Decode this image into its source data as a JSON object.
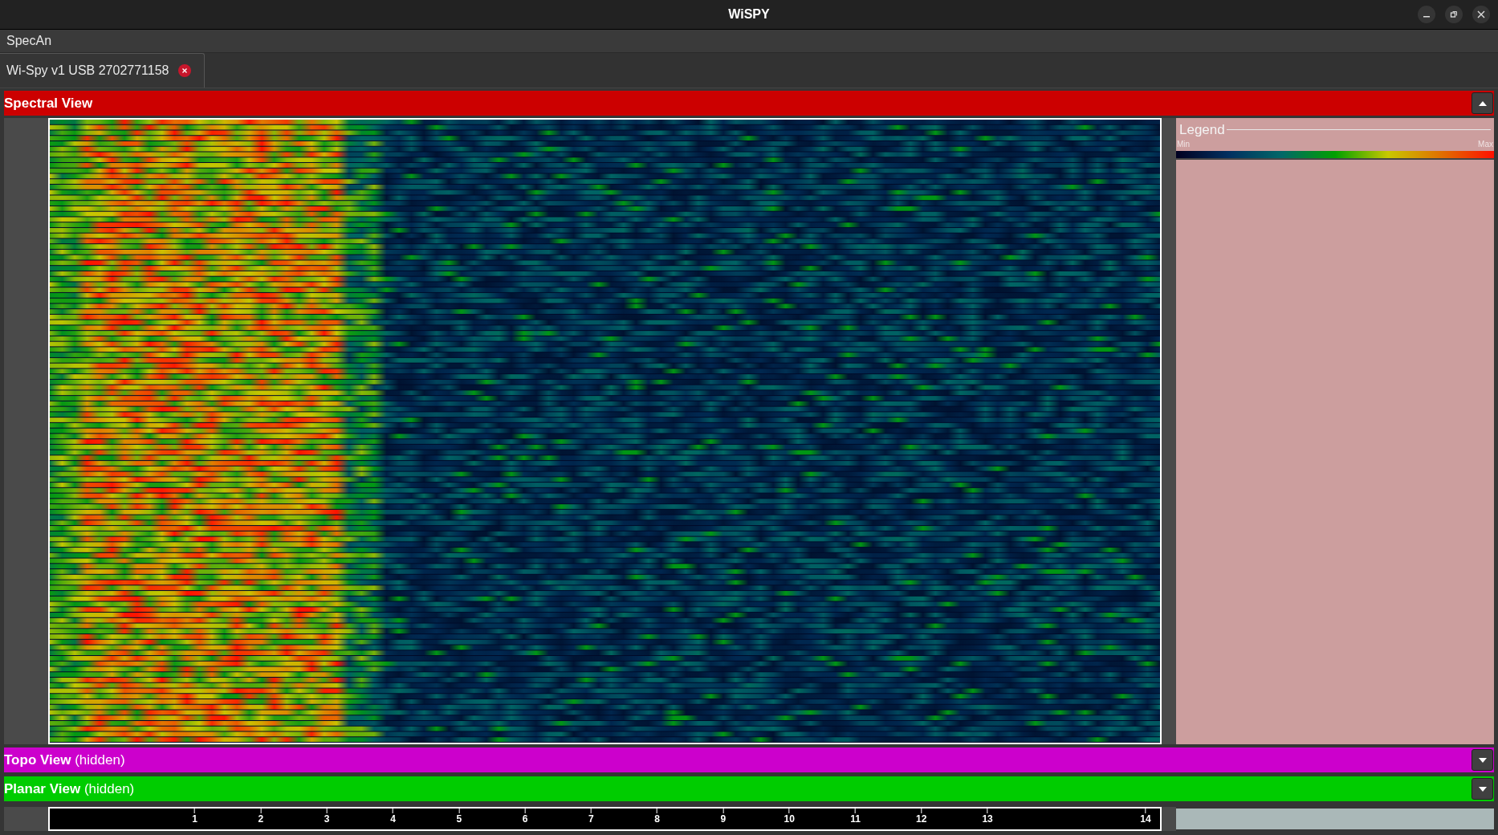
{
  "window": {
    "title": "WiSPY"
  },
  "menu": [
    {
      "label": "SpecAn"
    }
  ],
  "tabs": [
    {
      "label": "Wi-Spy v1 USB 2702771158",
      "selected": true
    }
  ],
  "panels": [
    {
      "title": "Spectral View",
      "color": "#cc0000",
      "expanded": true
    },
    {
      "title": "Topo View",
      "state": "(hidden)",
      "color": "#cc00cc",
      "expanded": false
    },
    {
      "title": "Planar View",
      "state": "(hidden)",
      "color": "#00cc00",
      "expanded": false
    }
  ],
  "legend": {
    "title": "Legend",
    "min_label": "Min",
    "max_label": "Max"
  },
  "axis": {
    "ticks": [
      "1",
      "2",
      "3",
      "4",
      "5",
      "6",
      "7",
      "8",
      "9",
      "10",
      "11",
      "12",
      "13",
      "14"
    ]
  }
}
